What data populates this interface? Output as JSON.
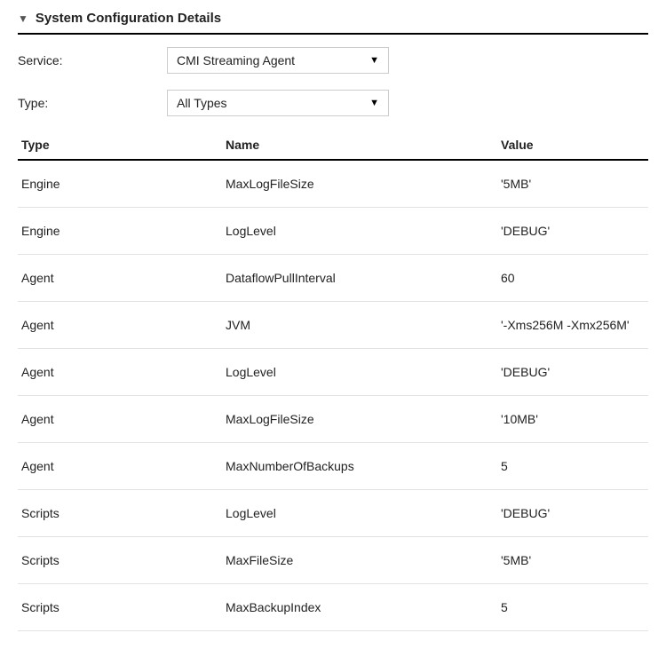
{
  "header": {
    "title": "System Configuration Details"
  },
  "filters": {
    "service": {
      "label": "Service:",
      "value": "CMI Streaming Agent"
    },
    "type": {
      "label": "Type:",
      "value": "All Types"
    }
  },
  "table": {
    "headers": {
      "type": "Type",
      "name": "Name",
      "value": "Value"
    },
    "rows": [
      {
        "type": "Engine",
        "name": "MaxLogFileSize",
        "value": "'5MB'"
      },
      {
        "type": "Engine",
        "name": "LogLevel",
        "value": "'DEBUG'"
      },
      {
        "type": "Agent",
        "name": "DataflowPullInterval",
        "value": "60"
      },
      {
        "type": "Agent",
        "name": "JVM",
        "value": "'-Xms256M -Xmx256M'"
      },
      {
        "type": "Agent",
        "name": "LogLevel",
        "value": "'DEBUG'"
      },
      {
        "type": "Agent",
        "name": "MaxLogFileSize",
        "value": "'10MB'"
      },
      {
        "type": "Agent",
        "name": "MaxNumberOfBackups",
        "value": "5"
      },
      {
        "type": "Scripts",
        "name": "LogLevel",
        "value": "'DEBUG'"
      },
      {
        "type": "Scripts",
        "name": "MaxFileSize",
        "value": "'5MB'"
      },
      {
        "type": "Scripts",
        "name": "MaxBackupIndex",
        "value": "5"
      }
    ]
  }
}
